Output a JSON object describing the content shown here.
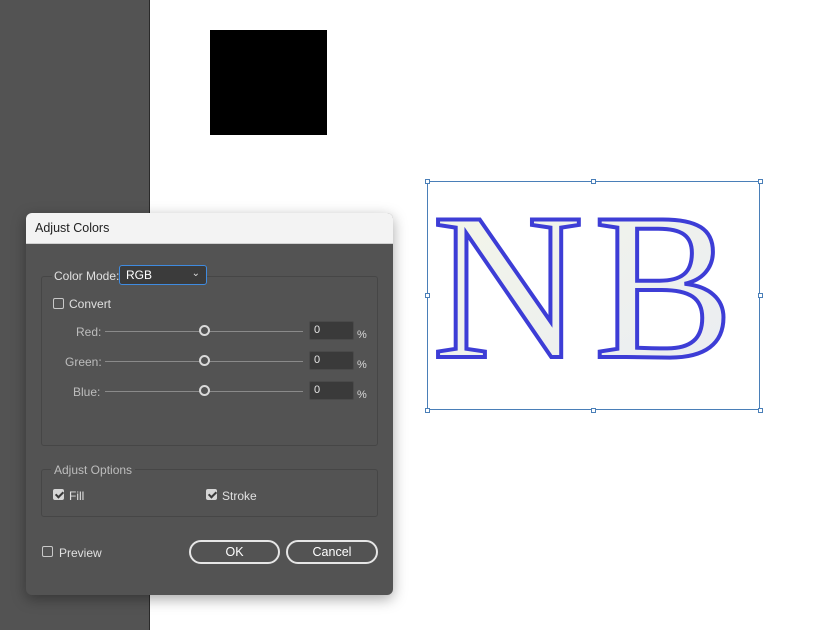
{
  "dialog": {
    "title": "Adjust Colors",
    "color_mode_label": "Color Mode:",
    "color_mode_value": "RGB",
    "convert_label": "Convert",
    "convert_checked": false,
    "sliders": [
      {
        "label": "Red:",
        "value": "0",
        "unit": "%",
        "level": 0.5
      },
      {
        "label": "Green:",
        "value": "0",
        "unit": "%",
        "level": 0.5
      },
      {
        "label": "Blue:",
        "value": "0",
        "unit": "%",
        "level": 0.5
      }
    ],
    "adjust_options_title": "Adjust Options",
    "fill_label": "Fill",
    "fill_checked": true,
    "stroke_label": "Stroke",
    "stroke_checked": true,
    "preview_label": "Preview",
    "preview_checked": false,
    "ok_label": "OK",
    "cancel_label": "Cancel"
  },
  "canvas": {
    "artwork_text": "NB",
    "artwork_color": "#3d3dd6",
    "selection_color": "#4a7fb8"
  },
  "colors": {
    "dialog_bg": "#535353",
    "pasteboard": "#535353",
    "accent": "#3f8be0"
  }
}
